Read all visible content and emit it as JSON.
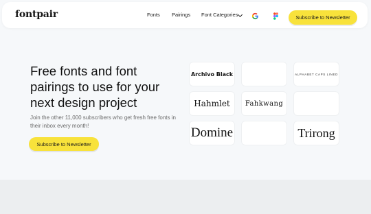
{
  "nav": {
    "logo": "fontpair",
    "links": [
      "Fonts",
      "Pairings",
      "Font Categories"
    ],
    "icons": [
      "google-icon",
      "figma-icon",
      "chevron-down-icon"
    ],
    "subscribe_label": "Subscribe to Newsletter"
  },
  "hero": {
    "title": "Free fonts and font pairings to use for your next design project",
    "subtitle": "Join the other 11,000 subscribers who get fresh free fonts in their inbox every month!",
    "subscribe_label": "Subscribe to Newsletter"
  },
  "tiles": [
    [
      "Archivo Black",
      "",
      "ALPHABET CAPS LINED"
    ],
    [
      "Hahmlet",
      "Fahkwang",
      ""
    ],
    [
      "Domine",
      "",
      "Trirong"
    ]
  ],
  "colors": {
    "accent": "#f8e23b",
    "page_bg": "#f6f8fa",
    "band_bg": "#eceef0"
  }
}
